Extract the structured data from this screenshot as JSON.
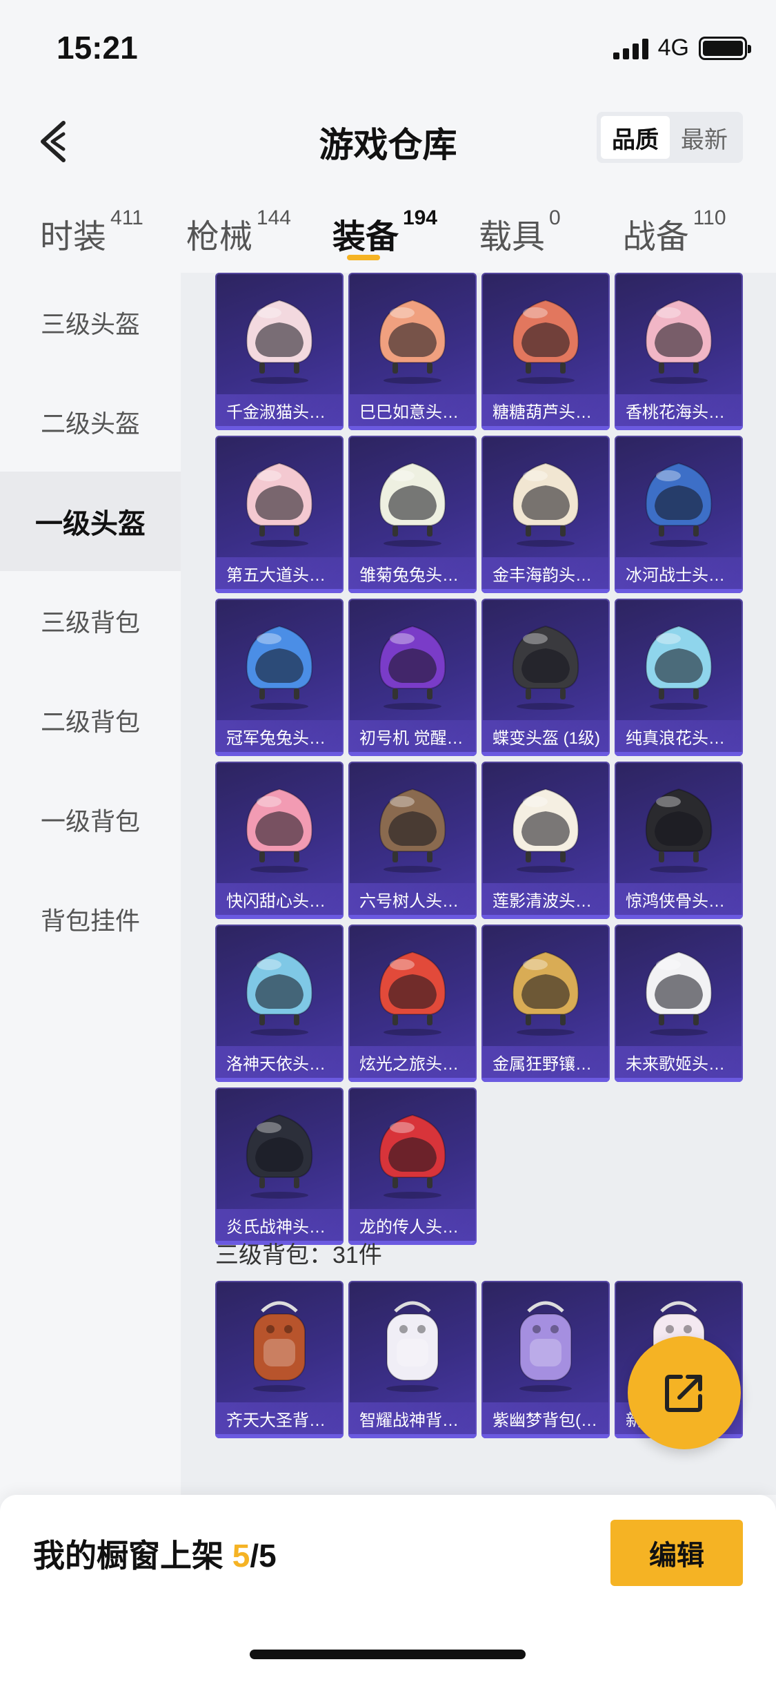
{
  "status_bar": {
    "time": "15:21",
    "network": "4G"
  },
  "header": {
    "title": "游戏仓库",
    "sort_options": [
      "品质",
      "最新"
    ],
    "sort_active": "品质"
  },
  "tabs": [
    {
      "label": "时装",
      "count": "411"
    },
    {
      "label": "枪械",
      "count": "144"
    },
    {
      "label": "装备",
      "count": "194",
      "active": true
    },
    {
      "label": "载具",
      "count": "0"
    },
    {
      "label": "战备",
      "count": "110"
    }
  ],
  "sidebar": {
    "items": [
      "三级头盔",
      "二级头盔",
      "一级头盔",
      "三级背包",
      "二级背包",
      "一级背包",
      "背包挂件"
    ],
    "active": "一级头盔"
  },
  "helmet_items": [
    {
      "name": "千金淑猫头…",
      "color": "#f3d9df"
    },
    {
      "name": "巳巳如意头…",
      "color": "#f0a07f"
    },
    {
      "name": "糖糖葫芦头…",
      "color": "#e2775e"
    },
    {
      "name": "香桃花海头…",
      "color": "#f1b6c6"
    },
    {
      "name": "第五大道头…",
      "color": "#f4c9d1"
    },
    {
      "name": "雏菊兔兔头…",
      "color": "#eef0e1"
    },
    {
      "name": "金丰海韵头…",
      "color": "#f1e6d2"
    },
    {
      "name": "冰河战士头…",
      "color": "#3d6fc7"
    },
    {
      "name": "冠军兔兔头…",
      "color": "#4b8ee6"
    },
    {
      "name": "初号机 觉醒…",
      "color": "#7a3cc8"
    },
    {
      "name": "蝶变头盔 (1级)",
      "color": "#3a3a3e"
    },
    {
      "name": "纯真浪花头…",
      "color": "#8fd5ec"
    },
    {
      "name": "快闪甜心头…",
      "color": "#f29bb3"
    },
    {
      "name": "六号树人头…",
      "color": "#8a6a4f"
    },
    {
      "name": "莲影清波头…",
      "color": "#f5efe2"
    },
    {
      "name": "惊鸿侠骨头…",
      "color": "#2a2a2e"
    },
    {
      "name": "洛神天依头…",
      "color": "#7fc8e6"
    },
    {
      "name": "炫光之旅头…",
      "color": "#e24a3a"
    },
    {
      "name": "金属狂野镶…",
      "color": "#d9ac55"
    },
    {
      "name": "未来歌姬头…",
      "color": "#f2f2f4"
    },
    {
      "name": "炎氏战神头…",
      "color": "#2c2f3a"
    },
    {
      "name": "龙的传人头…",
      "color": "#d8343a"
    }
  ],
  "backpack_section": {
    "title": "三级背包：31件"
  },
  "backpack_items": [
    {
      "name": "齐天大圣背…",
      "color": "#b8542c"
    },
    {
      "name": "智耀战神背…",
      "color": "#f0eef6"
    },
    {
      "name": "紫幽梦背包(…",
      "color": "#a58fe0"
    },
    {
      "name": "新…",
      "color": "#f4e9f1"
    }
  ],
  "bottom_bar": {
    "label": "我的橱窗上架 ",
    "count": "5",
    "total": "/5",
    "edit_label": "编辑"
  }
}
